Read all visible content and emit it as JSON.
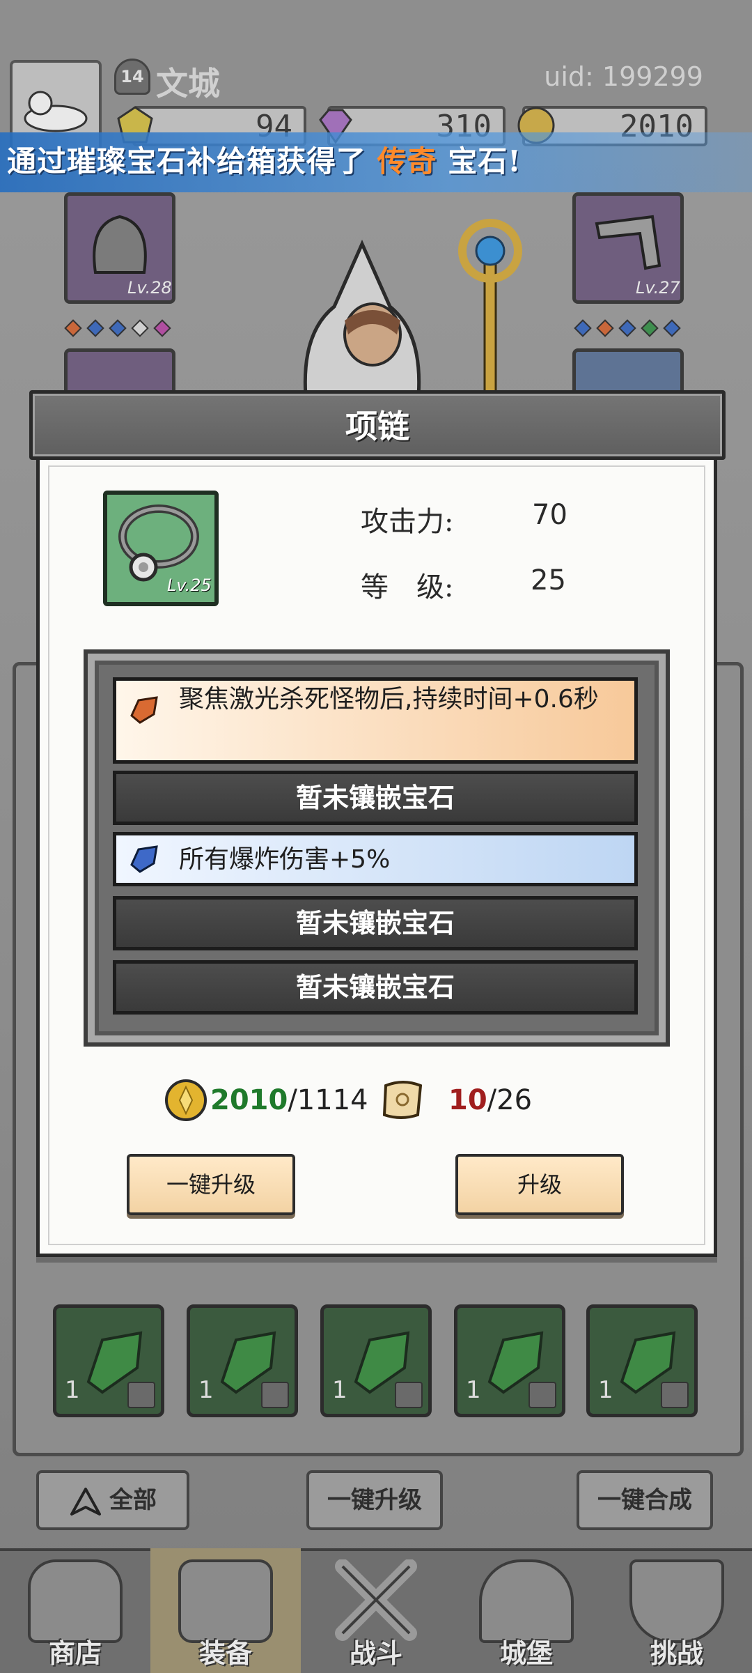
{
  "player": {
    "level": "14",
    "name": "文城",
    "uid": "uid: 199299"
  },
  "resources": {
    "yellow_gems": "94",
    "purple_gems": "310",
    "gold": "2010"
  },
  "notification": {
    "prefix": "通过璀璨宝石补给箱获得了",
    "highlight": "传奇",
    "suffix": "宝石!",
    "highlight_color": "#ff8a2a"
  },
  "equipment_slots": {
    "left_level": "Lv.28",
    "right_level": "Lv.27"
  },
  "dialog": {
    "title": "项链",
    "item_level": "Lv.25",
    "attack_label": "攻击力:",
    "attack_value": "70",
    "level_label": "等　级:",
    "level_value": "25",
    "slots": [
      {
        "type": "gem",
        "color": "orange",
        "text": "聚焦激光杀死怪物后,持续时间+0.6秒"
      },
      {
        "type": "empty",
        "text": "暂未镶嵌宝石"
      },
      {
        "type": "gem",
        "color": "blue",
        "text": "所有爆炸伤害+5%"
      },
      {
        "type": "empty",
        "text": "暂未镶嵌宝石"
      },
      {
        "type": "empty",
        "text": "暂未镶嵌宝石"
      }
    ],
    "gold_cost": {
      "have": "2010",
      "need": "/1114"
    },
    "scroll_cost": {
      "have": "10",
      "need": "/26"
    },
    "btn_upgrade_all": "一键升级",
    "btn_upgrade": "升级"
  },
  "inventory": {
    "gem_counts": [
      "1",
      "1",
      "1",
      "1",
      "1"
    ]
  },
  "bottom_actions": {
    "filter": "全部",
    "upgrade_all": "一键升级",
    "merge_all": "一键合成"
  },
  "nav": {
    "shop": "商店",
    "equip": "装备",
    "battle": "战斗",
    "castle": "城堡",
    "challenge": "挑战"
  },
  "colors": {
    "accent_green": "#1f7a2b",
    "accent_red": "#a01e1e",
    "button_bg": "#f3d3a4"
  }
}
